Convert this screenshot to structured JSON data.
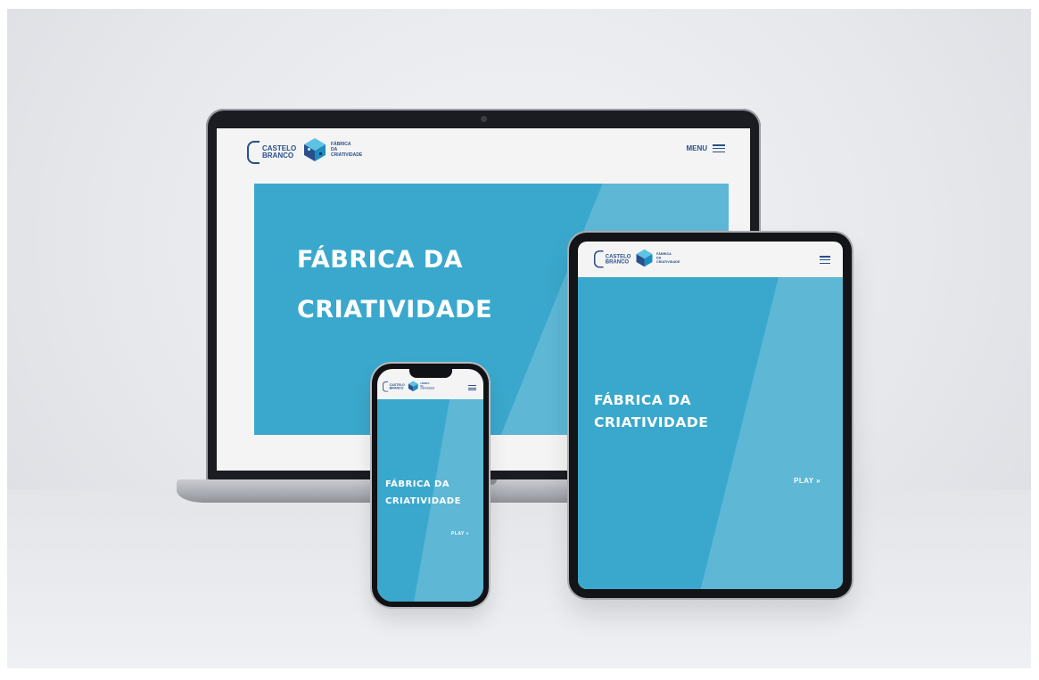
{
  "brand": {
    "castelo_line1": "CASTELO",
    "castelo_line2": "BRANCO",
    "fabrica_line1": "FÁBRICA",
    "fabrica_line2": "DA",
    "fabrica_line3": "CRIATIVIDADE"
  },
  "header": {
    "menu_label": "MENU"
  },
  "hero": {
    "title_line1": "FÁBRICA DA",
    "title_line2": "CRIATIVIDADE",
    "play_label": "PLAY »"
  },
  "colors": {
    "hero_blue": "#3aa8cc",
    "brand_navy": "#2a4f8a"
  }
}
